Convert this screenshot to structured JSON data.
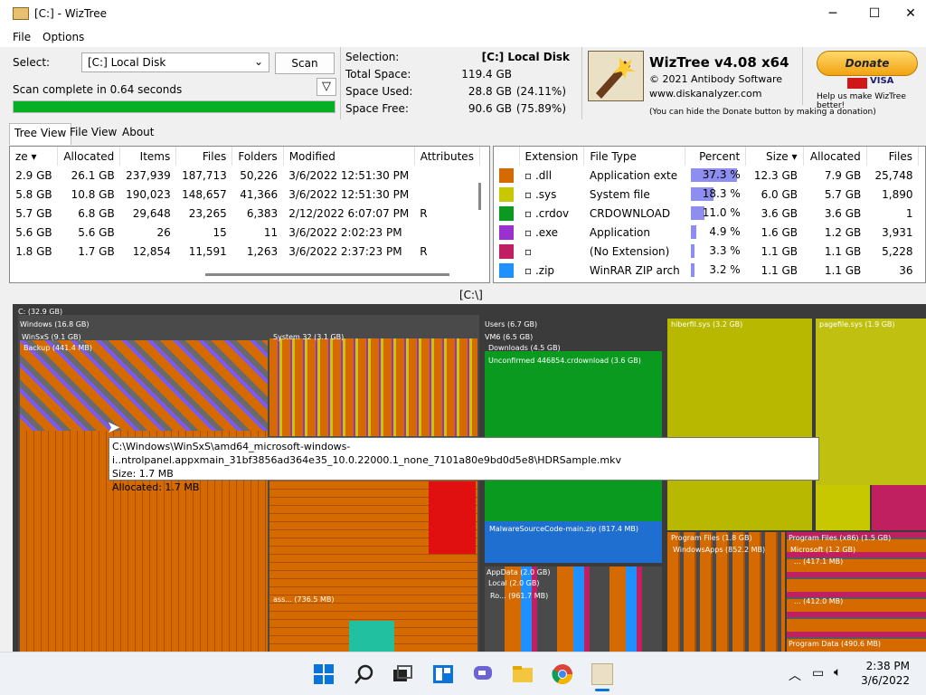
{
  "window": {
    "title": "[C:] - WizTree",
    "minimize": "─",
    "maximize": "☐",
    "close": "✕"
  },
  "menu": [
    "File",
    "Options"
  ],
  "scan": {
    "select_label": "Select:",
    "drive": "[C:] Local Disk",
    "scan_button": "Scan",
    "status": "Scan complete in 0.64 seconds",
    "progress": 1.0
  },
  "info": {
    "labels": [
      "Selection:",
      "Total Space:",
      "Space Used:",
      "Space Free:"
    ],
    "selection": "[C:]  Local Disk",
    "total": "119.4 GB",
    "used": "28.8 GB",
    "used_pct": "(24.11%)",
    "free": "90.6 GB",
    "free_pct": "(75.89%)"
  },
  "about": {
    "product": "WizTree v4.08 x64",
    "copyright": "© 2021 Antibody Software",
    "url": "www.diskanalyzer.com",
    "note": "(You can hide the Donate button by making a donation)",
    "donate": "Donate",
    "donate_note": "Help us make WizTree better!",
    "cards": "VISA"
  },
  "tabs": [
    "Tree View",
    "File View",
    "About"
  ],
  "tree": {
    "headers": [
      "ze",
      "Allocated",
      "Items",
      "Files",
      "Folders",
      "Modified",
      "Attributes"
    ],
    "rows": [
      [
        "2.9 GB",
        "26.1 GB",
        "237,939",
        "187,713",
        "50,226",
        "3/6/2022 12:51:30 PM",
        ""
      ],
      [
        "5.8 GB",
        "10.8 GB",
        "190,023",
        "148,657",
        "41,366",
        "3/6/2022 12:51:30 PM",
        ""
      ],
      [
        "5.7 GB",
        "6.8 GB",
        "29,648",
        "23,265",
        "6,383",
        "2/12/2022 6:07:07 PM",
        "R"
      ],
      [
        "5.6 GB",
        "5.6 GB",
        "26",
        "15",
        "11",
        "3/6/2022 2:02:23 PM",
        ""
      ],
      [
        "1.8 GB",
        "1.7 GB",
        "12,854",
        "11,591",
        "1,263",
        "3/6/2022 2:37:23 PM",
        "R"
      ]
    ]
  },
  "ext": {
    "headers": [
      "Extension",
      "File Type",
      "Percent",
      "Size",
      "Allocated",
      "Files"
    ],
    "rows": [
      {
        "color": "#d46a00",
        "ext": ".dll",
        "type": "Application exte",
        "pct": 37.3,
        "pct_label": "37.3 %",
        "size": "12.3 GB",
        "alloc": "7.9 GB",
        "files": "25,748"
      },
      {
        "color": "#c8c800",
        "ext": ".sys",
        "type": "System file",
        "pct": 18.3,
        "pct_label": "18.3 %",
        "size": "6.0 GB",
        "alloc": "5.7 GB",
        "files": "1,890"
      },
      {
        "color": "#0a9a20",
        "ext": ".crdov",
        "type": "CRDOWNLOAD",
        "pct": 11.0,
        "pct_label": "11.0 %",
        "size": "3.6 GB",
        "alloc": "3.6 GB",
        "files": "1"
      },
      {
        "color": "#9a30d0",
        "ext": ".exe",
        "type": "Application",
        "pct": 4.9,
        "pct_label": "4.9 %",
        "size": "1.6 GB",
        "alloc": "1.2 GB",
        "files": "3,931"
      },
      {
        "color": "#c02060",
        "ext": "",
        "type": "(No Extension)",
        "pct": 3.3,
        "pct_label": "3.3 %",
        "size": "1.1 GB",
        "alloc": "1.1 GB",
        "files": "5,228"
      },
      {
        "color": "#1e90ff",
        "ext": ".zip",
        "type": "WinRAR ZIP arch",
        "pct": 3.2,
        "pct_label": "3.2 %",
        "size": "1.1 GB",
        "alloc": "1.1 GB",
        "files": "36"
      }
    ]
  },
  "path": "[C:\\]",
  "treemap": {
    "labels": [
      "C: (32.9 GB)",
      "Windows (16.8 GB)",
      "WinSxS (9.1 GB)",
      "Backup (441.4 MB)",
      "System 32 (3.1 GB)",
      "Users (6.7 GB)",
      "VM6 (6.5 GB)",
      "Downloads (4.5 GB)",
      "Unconfirmed 446854.crdownload (3.6 GB)",
      "hiberfil.sys (3.2 GB)",
      "pagefile.sys (1.9 GB)",
      "MalwareSourceCode-main.zip (817.4 MB)",
      "AppData (2.0 GB)",
      "Local (2.0 GB)",
      "Ro... (961.7 MB)",
      "Program Files (1.8 GB)",
      "WindowsApps (852.2 MB)",
      "Program Files (x86) (1.5 GB)",
      "Microsoft (1.2 GB)",
      "... (417.1 MB)",
      "... (412.0 MB)",
      "Program Data (490.6 MB)",
      "ass... (736.5 MB)"
    ]
  },
  "tooltip": {
    "path": "C:\\Windows\\WinSxS\\amd64_microsoft-windows-i..ntrolpanel.appxmain_31bf3856ad364e35_10.0.22000.1_none_7101a80e9bd0d5e8\\HDRSample.mkv",
    "size": "Size: 1.7 MB",
    "allocated": "Allocated: 1.7 MB"
  },
  "taskbar": {
    "time": "2:38 PM",
    "date": "3/6/2022"
  }
}
